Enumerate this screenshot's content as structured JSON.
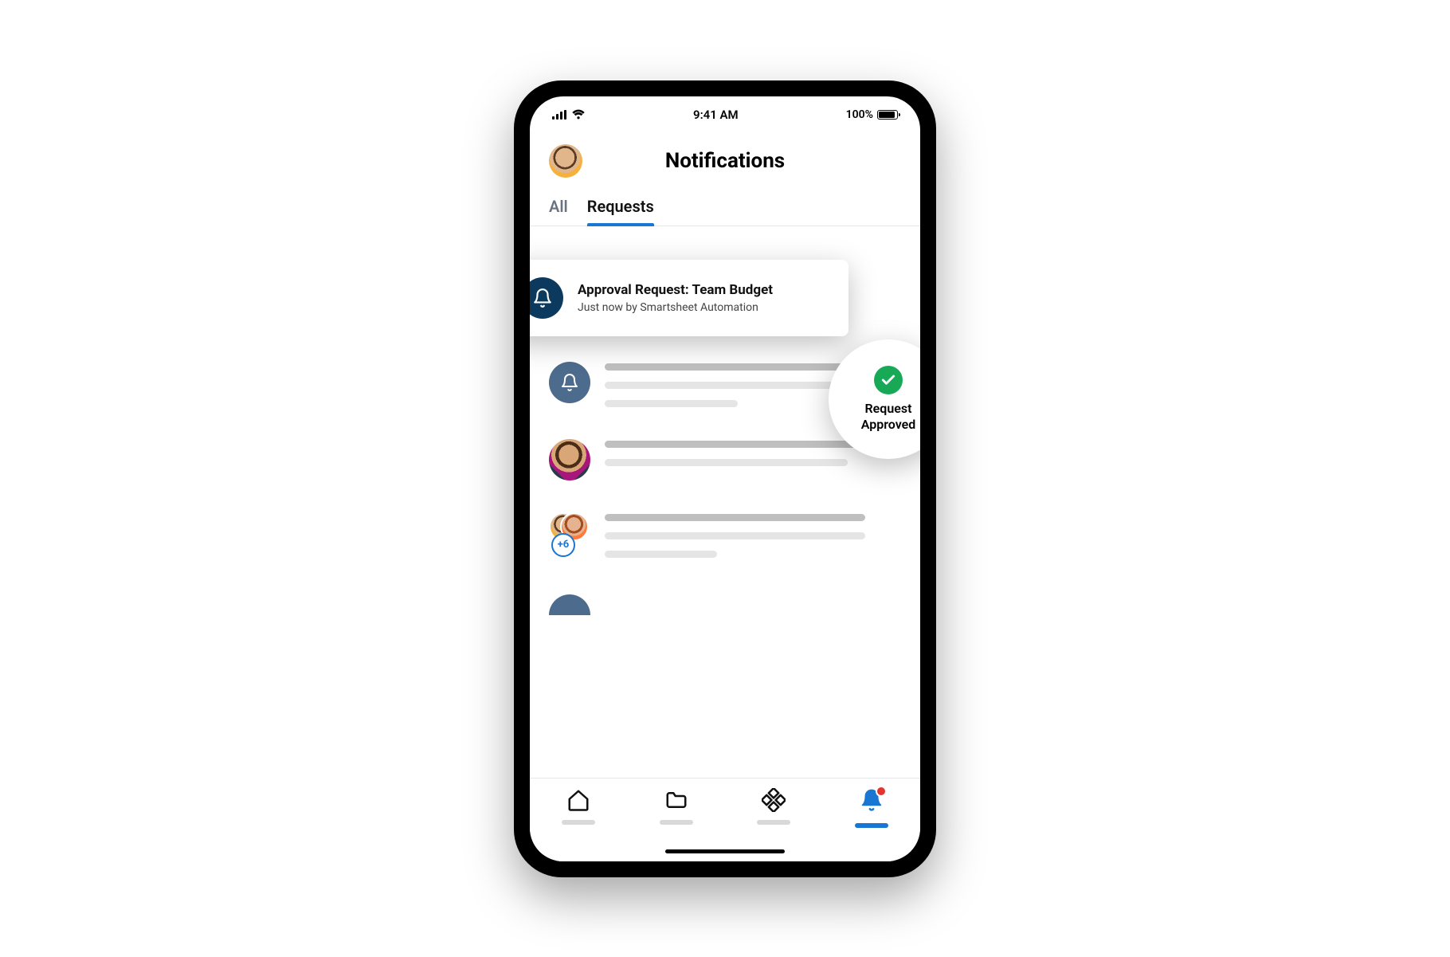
{
  "status_bar": {
    "time": "9:41 AM",
    "battery_percent": "100%"
  },
  "header": {
    "title": "Notifications"
  },
  "tabs": [
    {
      "label": "All",
      "active": false
    },
    {
      "label": "Requests",
      "active": true
    }
  ],
  "featured_notification": {
    "title": "Approval Request: Team Budget",
    "subtitle": "Just now by Smartsheet Automation"
  },
  "approved_badge": {
    "line1": "Request",
    "line2": "Approved"
  },
  "avatar_group_extra": "+6",
  "bottom_nav": {
    "items": [
      "home",
      "files",
      "apps",
      "notifications"
    ],
    "active_index": 3
  }
}
